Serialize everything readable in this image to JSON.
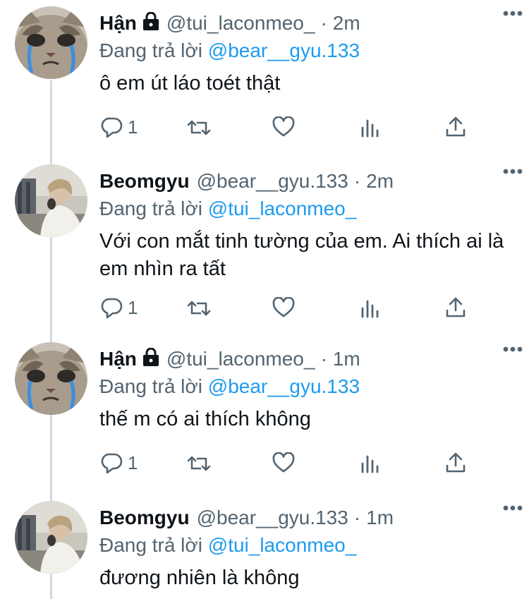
{
  "reply_prefix": "Đang trả lời",
  "tweets": [
    {
      "name": "Hận",
      "locked": true,
      "handle": "@tui_laconmeo_",
      "separator": "·",
      "time": "2m",
      "reply_to": "@bear__gyu.133",
      "text": "ô em út láo toét thật",
      "reply_count": "1",
      "avatar_icon": "crying-cat-avatar"
    },
    {
      "name": "Beomgyu",
      "locked": false,
      "handle": "@bear__gyu.133",
      "separator": "·",
      "time": "2m",
      "reply_to": "@tui_laconmeo_",
      "text": "Với con mắt tinh tường của em. Ai thích ai là em nhìn ra tất",
      "reply_count": "1",
      "avatar_icon": "person-photo-avatar"
    },
    {
      "name": "Hận",
      "locked": true,
      "handle": "@tui_laconmeo_",
      "separator": "·",
      "time": "1m",
      "reply_to": "@bear__gyu.133",
      "text": "thế m có ai thích không",
      "reply_count": "1",
      "avatar_icon": "crying-cat-avatar"
    },
    {
      "name": "Beomgyu",
      "locked": false,
      "handle": "@bear__gyu.133",
      "separator": "·",
      "time": "1m",
      "reply_to": "@tui_laconmeo_",
      "text": "đương nhiên là không",
      "reply_count": "",
      "avatar_icon": "person-photo-avatar"
    }
  ],
  "colors": {
    "text": "#0f1419",
    "secondary": "#536471",
    "link": "#1d9bf0",
    "thread_line": "#cfd9de"
  }
}
